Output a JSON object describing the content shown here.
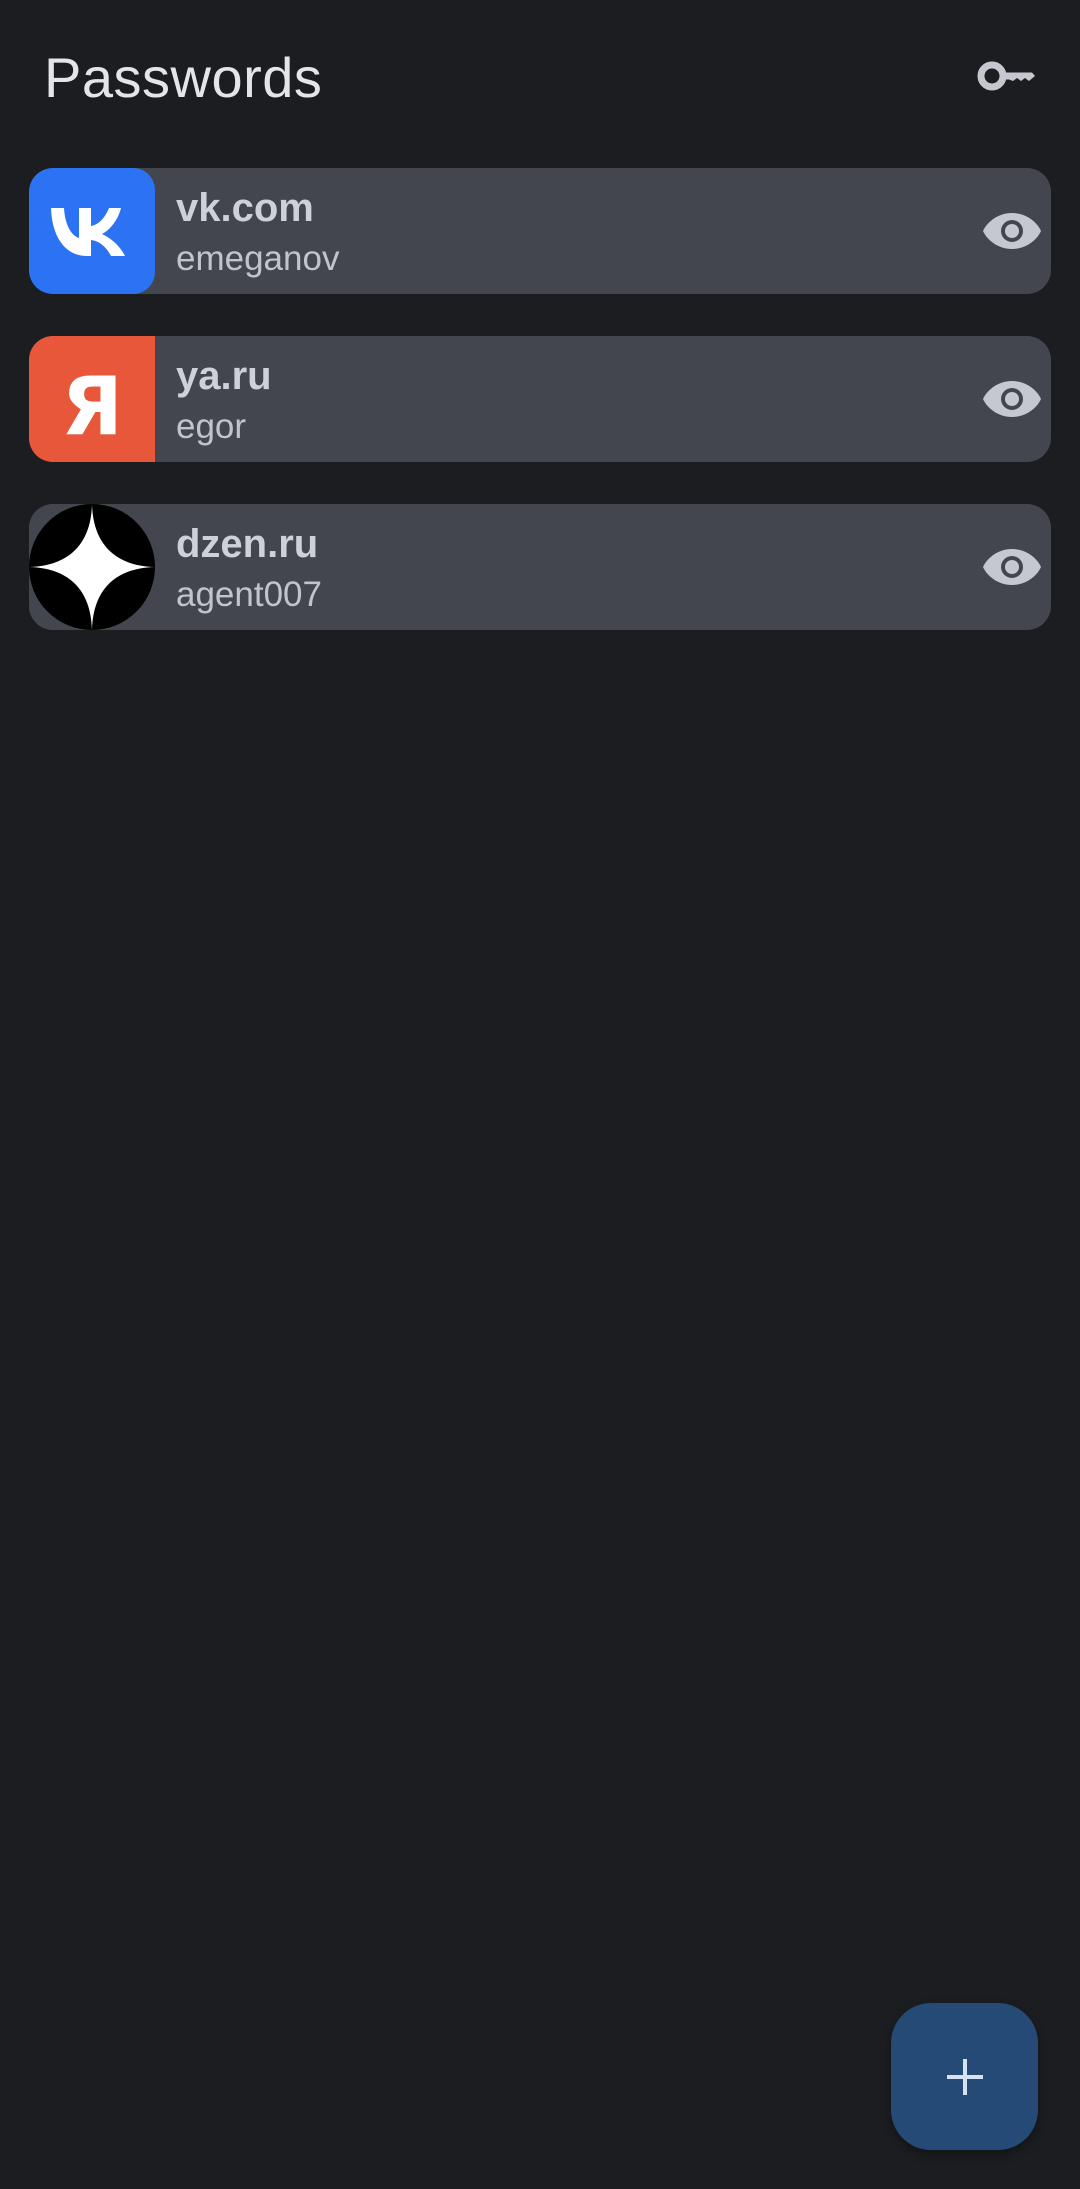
{
  "header": {
    "title": "Passwords",
    "action_icon": "key-icon"
  },
  "entries": [
    {
      "site": "vk.com",
      "username": "emeganov",
      "logo": "vk-logo",
      "logo_color": "#2c73f4",
      "action_icon": "eye-icon"
    },
    {
      "site": "ya.ru",
      "username": "egor",
      "logo": "yandex-logo",
      "logo_color": "#e9573a",
      "logo_text": "Я",
      "action_icon": "eye-icon"
    },
    {
      "site": "dzen.ru",
      "username": "agent007",
      "logo": "dzen-logo",
      "logo_color": "#000000",
      "action_icon": "eye-icon"
    }
  ],
  "fab": {
    "icon": "plus-icon"
  },
  "colors": {
    "background": "#1b1d21",
    "card": "#44464f",
    "fab": "#244a75",
    "icon": "#c6c8cf"
  }
}
